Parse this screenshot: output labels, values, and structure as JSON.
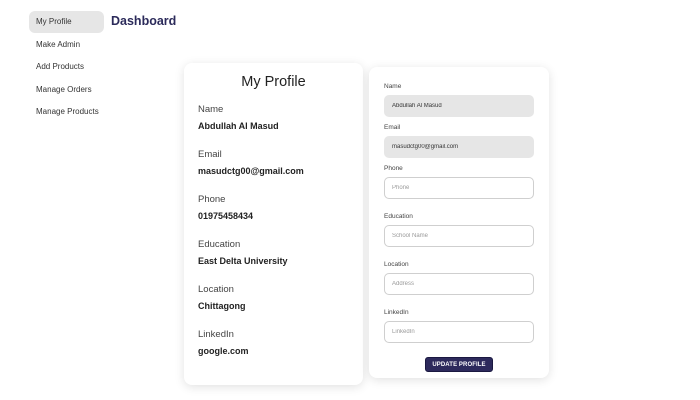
{
  "sidebar": {
    "items": [
      {
        "label": "My Profile",
        "active": true
      },
      {
        "label": "Make Admin"
      },
      {
        "label": "Add Products"
      },
      {
        "label": "Manage Orders"
      },
      {
        "label": "Manage Products"
      }
    ]
  },
  "header": {
    "title": "Dashboard"
  },
  "profile": {
    "title": "My Profile",
    "fields": [
      {
        "label": "Name",
        "value": "Abdullah Al Masud"
      },
      {
        "label": "Email",
        "value": "masudctg00@gmail.com"
      },
      {
        "label": "Phone",
        "value": "01975458434"
      },
      {
        "label": "Education",
        "value": "East Delta University"
      },
      {
        "label": "Location",
        "value": "Chittagong"
      },
      {
        "label": "LinkedIn",
        "value": "google.com"
      }
    ]
  },
  "form": {
    "name": {
      "label": "Name",
      "value": "Abdullah Al Masud"
    },
    "email": {
      "label": "Email",
      "value": "masudctg00@gmail.com"
    },
    "phone": {
      "label": "Phone",
      "placeholder": "Phone"
    },
    "education": {
      "label": "Education",
      "placeholder": "School Name"
    },
    "location": {
      "label": "Location",
      "placeholder": "Address"
    },
    "linkedin": {
      "label": "LinkedIn",
      "placeholder": "LinkedIn"
    },
    "submit_label": "UPDATE PROFILE"
  },
  "colors": {
    "accent": "#2d2a5c",
    "title": "#2b2a5a",
    "active_bg": "#e6e6e6"
  }
}
